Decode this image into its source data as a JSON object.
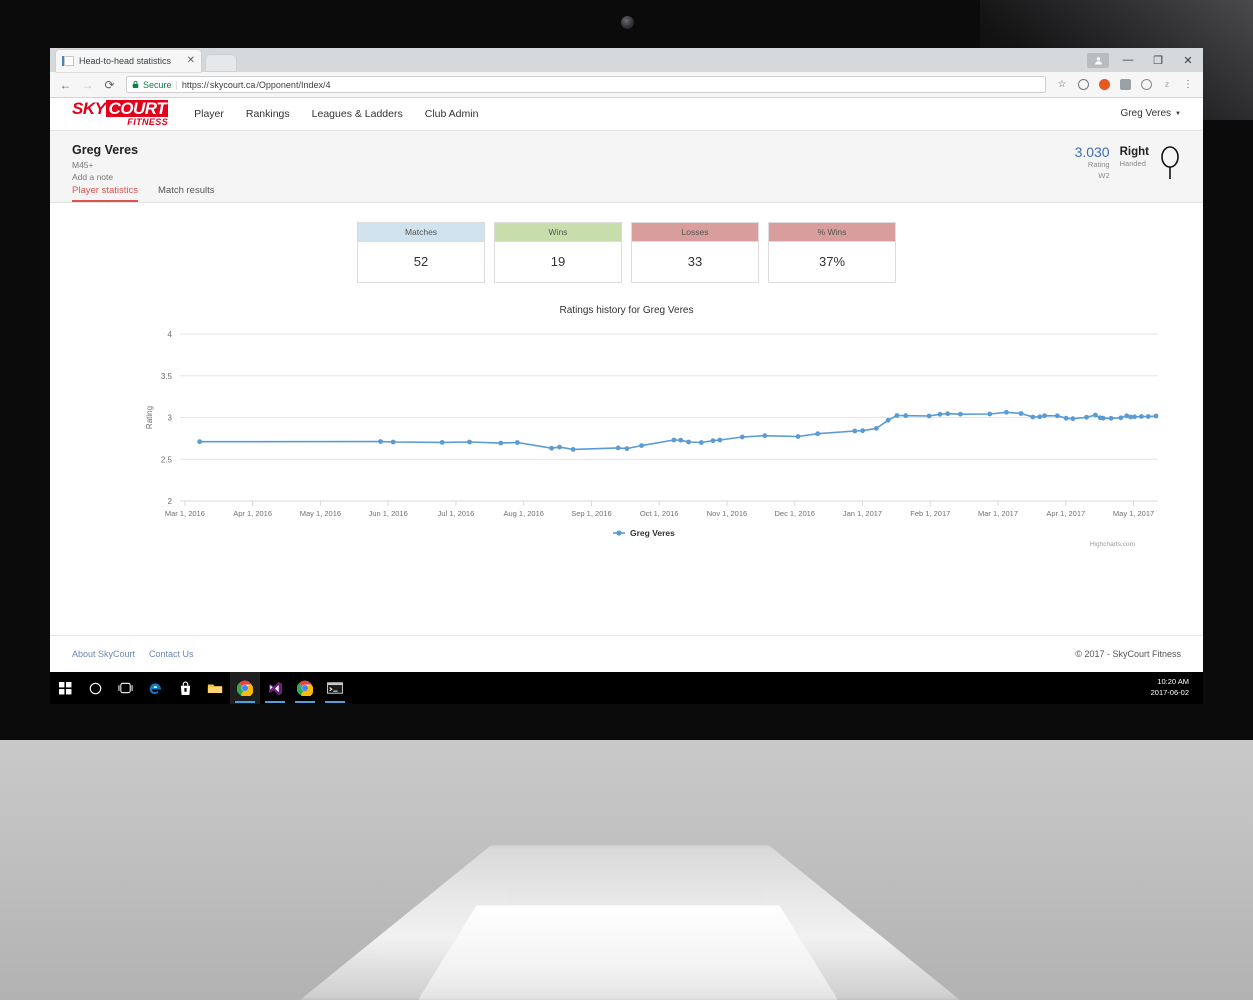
{
  "browser": {
    "tab": {
      "title": "Head-to-head statistics",
      "close": "✕"
    },
    "newtab_label": "",
    "window": {
      "minimize": "—",
      "maximize": "❐",
      "close": "✕"
    },
    "nav": {
      "back": "←",
      "forward": "→",
      "reload": "⟳"
    },
    "omnibox": {
      "lock": "🔒",
      "secure_label": "Secure",
      "separator": "|",
      "url_scheme": "https://",
      "url_host": "skycourt.ca",
      "url_path": "/Opponent/Index/4"
    },
    "toolbar_icons": [
      "star-icon",
      "extension-shield-icon",
      "extension-block-icon",
      "extension-pocket-icon",
      "extension-circle-icon",
      "extension-z-icon",
      "chrome-menu-icon"
    ]
  },
  "site": {
    "brand": {
      "sky": "SKY",
      "court": "COURT",
      "fitness": "FITNESS"
    },
    "nav_links": [
      {
        "label": "Player"
      },
      {
        "label": "Rankings"
      },
      {
        "label": "Leagues & Ladders"
      },
      {
        "label": "Club Admin"
      }
    ],
    "user_menu": {
      "label": "Greg Veres",
      "caret": "▼"
    }
  },
  "player": {
    "name": "Greg Veres",
    "category": "M45+",
    "note_link": "Add a note",
    "rating_value": "3.030",
    "rating_label": "Rating",
    "rating_sub": "W2",
    "hand_value": "Right",
    "hand_label": "Handed",
    "tabs": [
      {
        "label": "Player statistics",
        "active": true
      },
      {
        "label": "Match results",
        "active": false
      }
    ]
  },
  "stats": [
    {
      "label": "Matches",
      "value": "52",
      "color": "#cfe2ed"
    },
    {
      "label": "Wins",
      "value": "19",
      "color": "#c7ddab"
    },
    {
      "label": "Losses",
      "value": "33",
      "color": "#d99d9d"
    },
    {
      "label": "% Wins",
      "value": "37%",
      "color": "#d99d9d"
    }
  ],
  "chart_data": {
    "type": "line",
    "title": "Ratings history for Greg Veres",
    "xlabel": "",
    "ylabel": "Rating",
    "ylim": [
      2,
      4
    ],
    "yticks": [
      "2",
      "2.5",
      "3",
      "3.5",
      "4"
    ],
    "grid": true,
    "legend": {
      "position": "bottom",
      "entries": [
        "Greg Veres"
      ]
    },
    "credits": "Highcharts.com",
    "xticks": [
      "Mar 1, 2016",
      "Apr 1, 2016",
      "May 1, 2016",
      "Jun 1, 2016",
      "Jul 1, 2016",
      "Aug 1, 2016",
      "Sep 1, 2016",
      "Oct 1, 2016",
      "Nov 1, 2016",
      "Dec 1, 2016",
      "Jan 1, 2017",
      "Feb 1, 2017",
      "Mar 1, 2017",
      "Apr 1, 2017",
      "May 1, 2017"
    ],
    "series": [
      {
        "name": "Greg Veres",
        "color": "#5b9bd5",
        "points": [
          [
            0.02,
            2.71
          ],
          [
            0.205,
            2.712
          ],
          [
            0.218,
            2.706
          ],
          [
            0.268,
            2.702
          ],
          [
            0.296,
            2.706
          ],
          [
            0.328,
            2.694
          ],
          [
            0.345,
            2.7
          ],
          [
            0.38,
            2.632
          ],
          [
            0.388,
            2.645
          ],
          [
            0.402,
            2.618
          ],
          [
            0.448,
            2.636
          ],
          [
            0.457,
            2.628
          ],
          [
            0.472,
            2.664
          ],
          [
            0.505,
            2.73
          ],
          [
            0.512,
            2.728
          ],
          [
            0.52,
            2.706
          ],
          [
            0.533,
            2.7
          ],
          [
            0.545,
            2.722
          ],
          [
            0.552,
            2.73
          ],
          [
            0.575,
            2.766
          ],
          [
            0.598,
            2.782
          ],
          [
            0.632,
            2.772
          ],
          [
            0.652,
            2.806
          ],
          [
            0.69,
            2.838
          ],
          [
            0.698,
            2.842
          ],
          [
            0.712,
            2.87
          ],
          [
            0.724,
            2.966
          ],
          [
            0.733,
            3.024
          ],
          [
            0.742,
            3.022
          ],
          [
            0.766,
            3.018
          ],
          [
            0.777,
            3.038
          ],
          [
            0.785,
            3.046
          ],
          [
            0.798,
            3.04
          ],
          [
            0.828,
            3.042
          ],
          [
            0.845,
            3.062
          ],
          [
            0.86,
            3.048
          ],
          [
            0.872,
            3.006
          ],
          [
            0.879,
            3.008
          ],
          [
            0.884,
            3.022
          ],
          [
            0.897,
            3.02
          ],
          [
            0.906,
            2.992
          ],
          [
            0.913,
            2.986
          ],
          [
            0.927,
            3.002
          ],
          [
            0.936,
            3.03
          ],
          [
            0.941,
            2.996
          ],
          [
            0.944,
            2.992
          ],
          [
            0.952,
            2.99
          ],
          [
            0.962,
            2.996
          ],
          [
            0.968,
            3.02
          ],
          [
            0.972,
            3.006
          ],
          [
            0.976,
            3.008
          ],
          [
            0.983,
            3.012
          ],
          [
            0.99,
            3.012
          ],
          [
            0.998,
            3.018
          ]
        ]
      }
    ]
  },
  "footer": {
    "links": [
      {
        "label": "About SkyCourt"
      },
      {
        "label": "Contact Us"
      }
    ],
    "copyright": "© 2017 - SkyCourt Fitness"
  },
  "taskbar": {
    "items": [
      "start-icon",
      "cortana-search-icon",
      "task-view-icon",
      "edge-icon",
      "store-icon",
      "file-explorer-icon",
      "chrome-icon",
      "visual-studio-icon",
      "chrome-icon-2",
      "console-icon"
    ],
    "clock_time": "10:20 AM",
    "clock_date": "2017-06-02"
  }
}
